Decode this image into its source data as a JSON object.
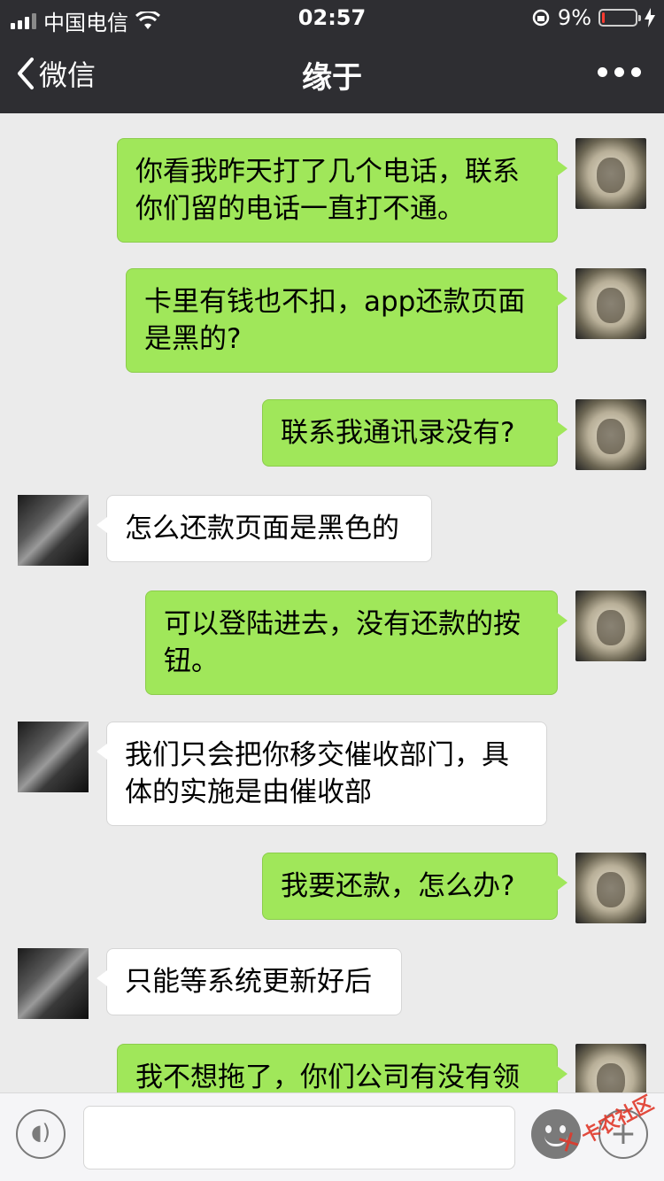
{
  "status_bar": {
    "carrier": "中国电信",
    "time": "02:57",
    "battery_text": "9%",
    "battery_level": 0.09,
    "battery_color": "#ff3b30",
    "icons": [
      "signal-icon",
      "wifi-icon",
      "rotation-lock-icon",
      "battery-icon",
      "charging-bolt-icon"
    ]
  },
  "nav": {
    "back_label": "微信",
    "title": "缘于",
    "more_icon": "more-dots-icon"
  },
  "messages": [
    {
      "from": "me",
      "lines": [
        "你看我昨天打了几个电话，联系",
        "你们留的电话一直打不通。"
      ]
    },
    {
      "from": "me",
      "lines": [
        "卡里有钱也不扣，app还款页面",
        "是黑的?"
      ]
    },
    {
      "from": "me",
      "lines": [
        "联系我通讯录没有?"
      ]
    },
    {
      "from": "other",
      "lines": [
        "怎么还款页面是黑色的"
      ]
    },
    {
      "from": "me",
      "lines": [
        "可以登陆进去，没有还款的按",
        "钮。"
      ]
    },
    {
      "from": "other",
      "lines": [
        "我们只会把你移交催收部门，具",
        "体的实施是由催收部"
      ]
    },
    {
      "from": "me",
      "lines": [
        "我要还款，怎么办?"
      ]
    },
    {
      "from": "other",
      "lines": [
        "只能等系统更新好后"
      ]
    },
    {
      "from": "me",
      "lines": [
        "我不想拖了，你们公司有没有领"
      ]
    }
  ],
  "input_bar": {
    "voice_icon": "voice-icon",
    "emoji_icon": "emoji-icon",
    "plus_icon": "plus-icon",
    "input_value": ""
  },
  "watermark": {
    "text": "卡农社区"
  },
  "colors": {
    "header_bg": "#2e2e32",
    "chat_bg": "#ebebeb",
    "my_bubble": "#a0e75a",
    "other_bubble": "#ffffff"
  }
}
